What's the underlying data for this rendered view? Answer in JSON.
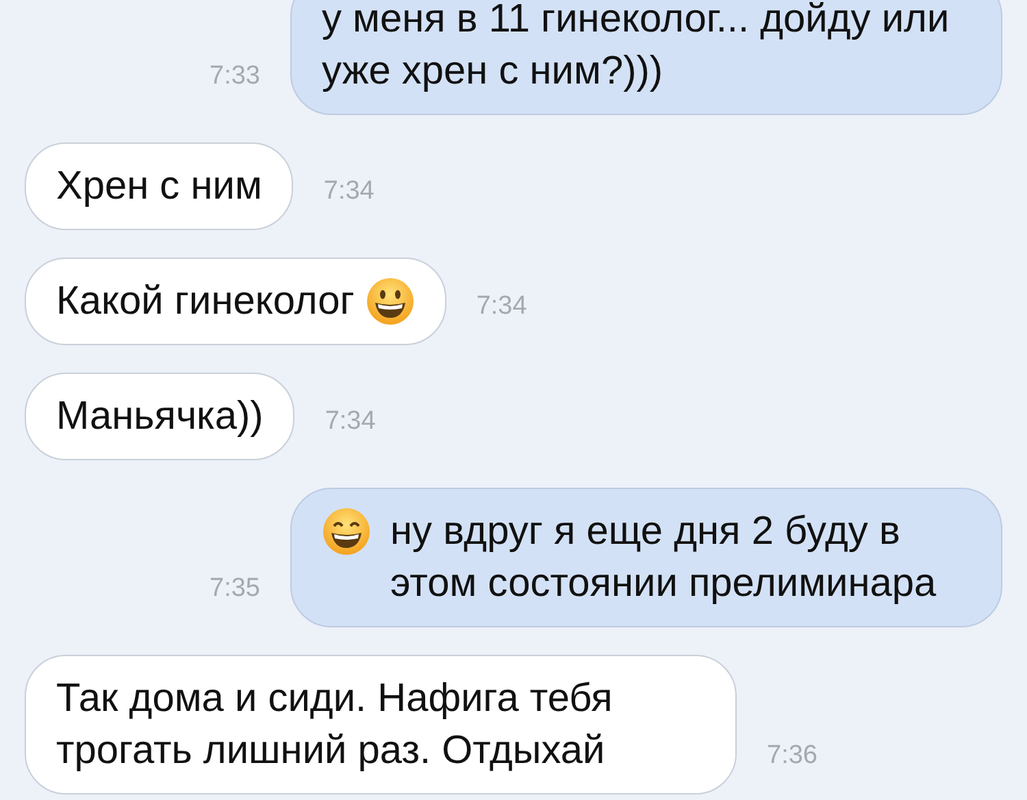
{
  "messages": [
    {
      "kind": "outgoing",
      "time": "7:33",
      "parts": [
        {
          "kind": "text",
          "text": "у меня в 11 гинеколог... дойду или уже хрен с ним?)))"
        }
      ]
    },
    {
      "kind": "incoming",
      "time": "7:34",
      "parts": [
        {
          "kind": "text",
          "text": "Хрен с ним"
        }
      ]
    },
    {
      "kind": "incoming",
      "time": "7:34",
      "parts": [
        {
          "kind": "text",
          "text": "Какой гинеколог"
        },
        {
          "kind": "emoji"
        }
      ]
    },
    {
      "kind": "incoming",
      "time": "7:34",
      "parts": [
        {
          "kind": "text",
          "text": "Маньячка))"
        }
      ]
    },
    {
      "kind": "outgoing",
      "time": "7:35",
      "parts": [
        {
          "kind": "emoji"
        },
        {
          "kind": "text",
          "text": "ну вдруг я еще дня 2 буду в этом состоянии прелиминара"
        }
      ]
    },
    {
      "kind": "incoming",
      "time": "7:36",
      "parts": [
        {
          "kind": "text",
          "text": "Так дома и сиди. Нафига тебя трогать лишний раз. Отдыхай"
        }
      ]
    }
  ]
}
